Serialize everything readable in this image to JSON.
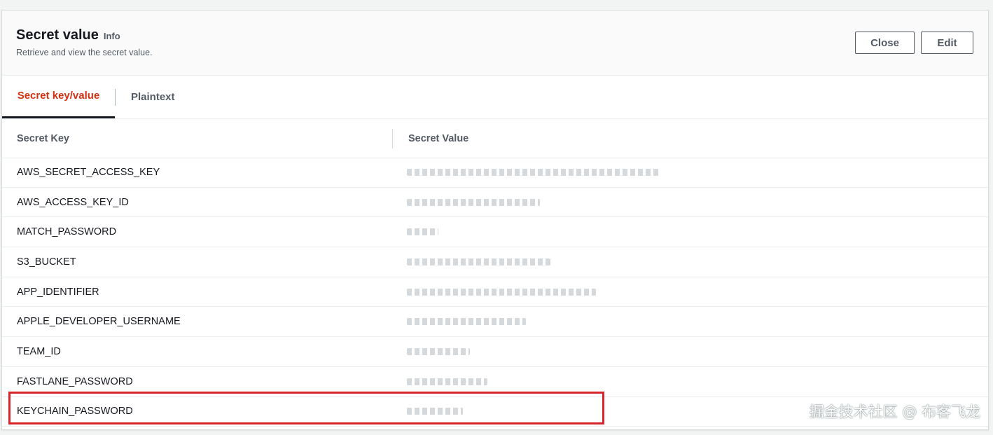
{
  "header": {
    "title": "Secret value",
    "info": "Info",
    "subtitle": "Retrieve and view the secret value.",
    "close_label": "Close",
    "edit_label": "Edit"
  },
  "tabs": [
    {
      "label": "Secret key/value",
      "active": true
    },
    {
      "label": "Plaintext",
      "active": false
    }
  ],
  "table": {
    "columns": [
      "Secret Key",
      "Secret Value"
    ],
    "rows": [
      {
        "key": "AWS_SECRET_ACCESS_KEY",
        "value_redacted": true
      },
      {
        "key": "AWS_ACCESS_KEY_ID",
        "value_redacted": true
      },
      {
        "key": "MATCH_PASSWORD",
        "value_redacted": true
      },
      {
        "key": "S3_BUCKET",
        "value_redacted": true
      },
      {
        "key": "APP_IDENTIFIER",
        "value_redacted": true
      },
      {
        "key": "APPLE_DEVELOPER_USERNAME",
        "value_redacted": true
      },
      {
        "key": "TEAM_ID",
        "value_redacted": true
      },
      {
        "key": "FASTLANE_PASSWORD",
        "value_redacted": true
      },
      {
        "key": "KEYCHAIN_PASSWORD",
        "value_redacted": true
      }
    ],
    "highlighted_row": "KEYCHAIN_PASSWORD"
  },
  "watermark": "掘金技术社区 @ 布客飞龙",
  "colors": {
    "active_tab": "#d13212",
    "highlight_border": "#d6262b",
    "text": "#16191f",
    "muted": "#545b64"
  }
}
